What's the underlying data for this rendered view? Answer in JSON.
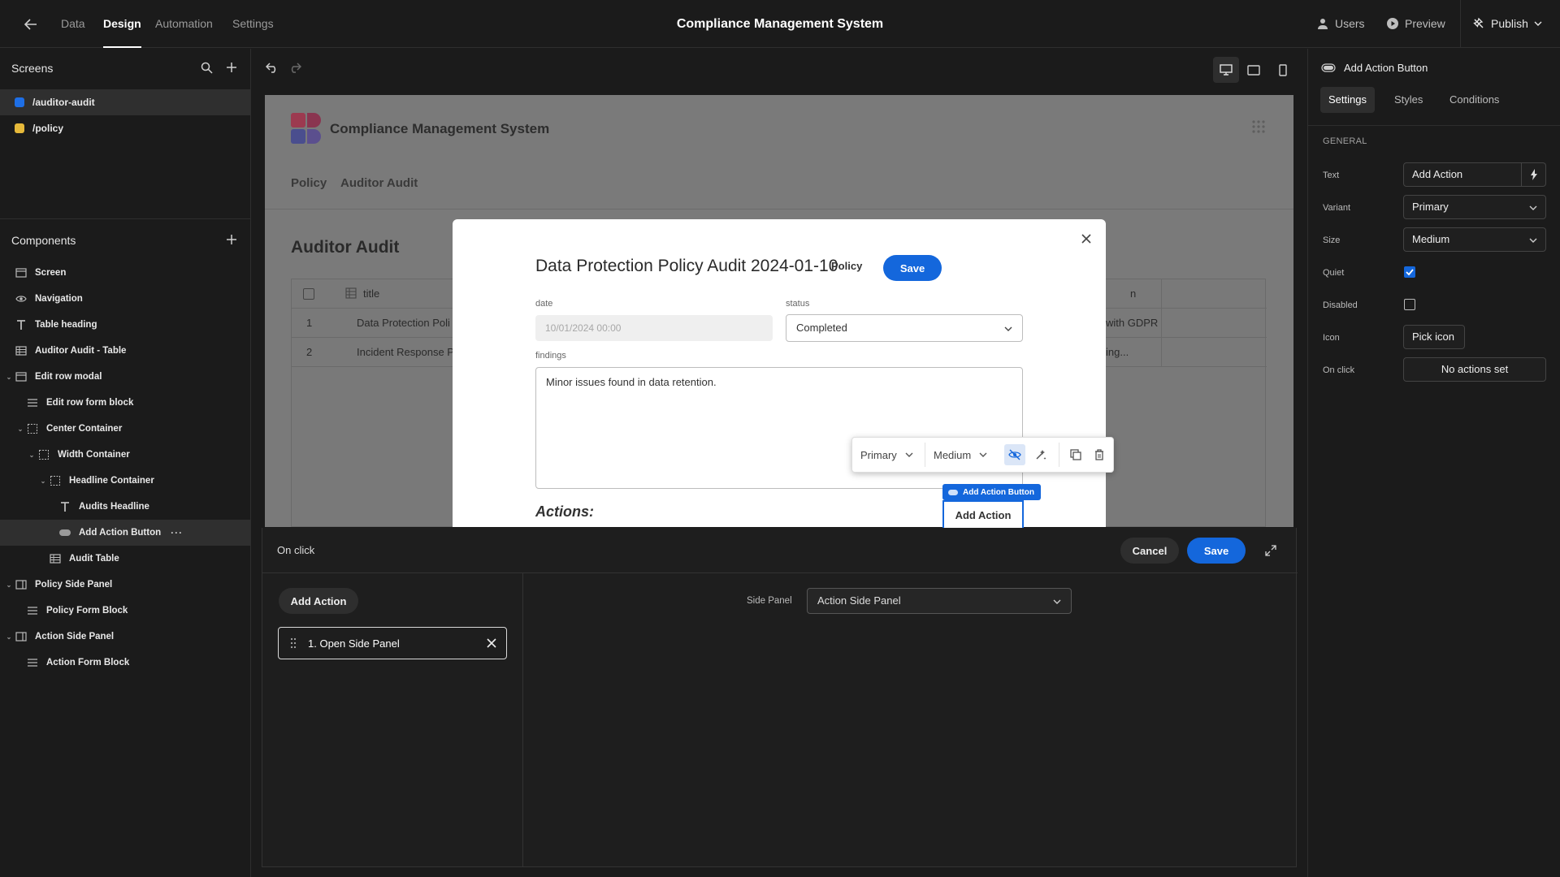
{
  "topbar": {
    "tabs": [
      "Data",
      "Design",
      "Automation",
      "Settings"
    ],
    "active_tab": "Design",
    "app_title": "Compliance Management System",
    "users_label": "Users",
    "preview_label": "Preview",
    "publish_label": "Publish"
  },
  "screens": {
    "heading": "Screens",
    "items": [
      {
        "path": "/auditor-audit",
        "color": "#1e6fe6",
        "selected": true
      },
      {
        "path": "/policy",
        "color": "#e6b93a",
        "selected": false
      }
    ]
  },
  "components": {
    "heading": "Components",
    "items": [
      {
        "label": "Screen",
        "icon": "screen-icon"
      },
      {
        "label": "Navigation",
        "icon": "eye-icon"
      },
      {
        "label": "Table heading",
        "icon": "text-icon"
      },
      {
        "label": "Auditor Audit - Table",
        "icon": "table-icon"
      },
      {
        "label": "Edit row modal",
        "icon": "modal-icon"
      },
      {
        "label": "Edit row form block",
        "icon": "form-icon"
      },
      {
        "label": "Center Container",
        "icon": "container-icon"
      },
      {
        "label": "Width Container",
        "icon": "container-icon"
      },
      {
        "label": "Headline Container",
        "icon": "container-icon"
      },
      {
        "label": "Audits Headline",
        "icon": "text-icon"
      },
      {
        "label": "Add Action Button",
        "icon": "button-icon"
      },
      {
        "label": "Audit Table",
        "icon": "table-icon"
      },
      {
        "label": "Policy Side Panel",
        "icon": "modal-icon"
      },
      {
        "label": "Policy Form Block",
        "icon": "form-icon"
      },
      {
        "label": "Action Side Panel",
        "icon": "modal-icon"
      },
      {
        "label": "Action Form Block",
        "icon": "form-icon"
      }
    ]
  },
  "preview": {
    "app_name": "Compliance Management System",
    "nav": [
      "Policy",
      "Auditor Audit"
    ],
    "page_heading": "Auditor Audit",
    "table": {
      "header_title": "title",
      "header_last": "n",
      "rows": [
        {
          "num": "1",
          "title": "Data Protection Poli",
          "tail": "with GDPR"
        },
        {
          "num": "2",
          "title": "Incident Response P",
          "tail": "ing..."
        }
      ]
    }
  },
  "modal": {
    "title": "Data Protection Policy Audit 2024-01-10",
    "policy_link": "Policy",
    "save_label": "Save",
    "date_label": "date",
    "date_value": "10/01/2024 00:00",
    "status_label": "status",
    "status_value": "Completed",
    "findings_label": "findings",
    "findings_value": "Minor issues found in data retention.",
    "actions_heading": "Actions:"
  },
  "float_toolbar": {
    "variant": "Primary",
    "size": "Medium"
  },
  "selected_component": {
    "tag": "Add Action Button",
    "button_label": "Add Action"
  },
  "onclick_panel": {
    "title": "On click",
    "cancel_label": "Cancel",
    "save_label": "Save",
    "add_action_label": "Add Action",
    "steps": [
      "1. Open Side Panel"
    ],
    "side_panel_label": "Side Panel",
    "side_panel_value": "Action Side Panel"
  },
  "settings_panel": {
    "component_name": "Add Action Button",
    "tabs": [
      "Settings",
      "Styles",
      "Conditions"
    ],
    "active_tab": "Settings",
    "section": "GENERAL",
    "fields": {
      "text_label": "Text",
      "text_value": "Add Action",
      "variant_label": "Variant",
      "variant_value": "Primary",
      "size_label": "Size",
      "size_value": "Medium",
      "quiet_label": "Quiet",
      "quiet_checked": true,
      "disabled_label": "Disabled",
      "disabled_checked": false,
      "icon_label": "Icon",
      "icon_value": "Pick icon",
      "onclick_label": "On click",
      "onclick_value": "No actions set"
    }
  },
  "colors": {
    "accent": "#1467dc",
    "background": "#1b1b1b"
  }
}
